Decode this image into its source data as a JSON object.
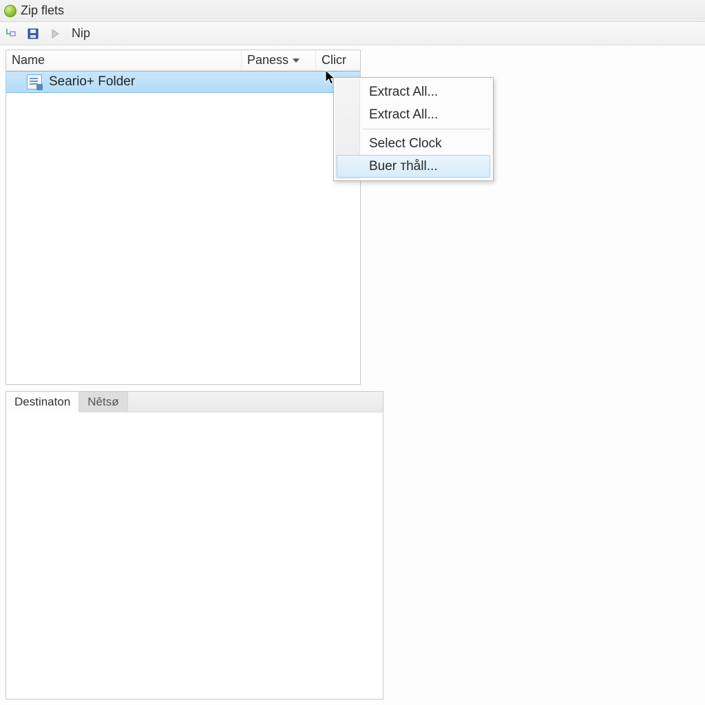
{
  "titlebar": {
    "title": "Zip flets"
  },
  "toolbar": {
    "nip_label": "Nip"
  },
  "list": {
    "columns": {
      "name": "Name",
      "paness": "Paness",
      "clicr": "Clicr"
    },
    "items": [
      {
        "label": "Seario+ Folder"
      }
    ]
  },
  "context_menu": {
    "items": [
      {
        "label": "Extract All...",
        "hovered": false
      },
      {
        "label": "Extract All...",
        "hovered": false
      },
      {
        "label": "Select Clock",
        "hovered": false,
        "sep_before": true
      },
      {
        "label": "Buer ᴛhåll...",
        "hovered": true
      }
    ]
  },
  "dest": {
    "tabs": [
      {
        "label": "Destinaton",
        "state": "active"
      },
      {
        "label": "Nêtsø",
        "state": "inactive"
      }
    ]
  }
}
